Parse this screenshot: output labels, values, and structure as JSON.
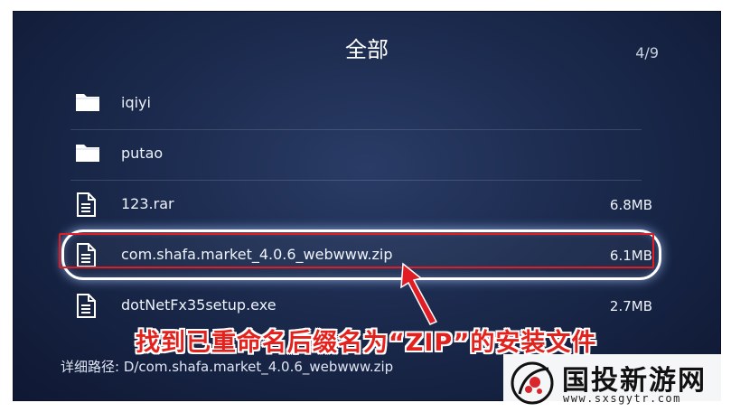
{
  "header": {
    "title": "全部",
    "page_counter": "4/9"
  },
  "files": [
    {
      "name": "iqiyi",
      "size": "",
      "icon": "folder-icon"
    },
    {
      "name": "putao",
      "size": "",
      "icon": "folder-icon"
    },
    {
      "name": "123.rar",
      "size": "6.8MB",
      "icon": "file-icon"
    },
    {
      "name": "com.shafa.market_4.0.6_webwww.zip",
      "size": "6.1MB",
      "icon": "file-icon",
      "selected": true
    },
    {
      "name": "dotNetFx35setup.exe",
      "size": "2.7MB",
      "icon": "file-icon"
    }
  ],
  "detail": {
    "path": "详细路径: D/com.shafa.market_4.0.6_webwww.zip"
  },
  "annotation": {
    "caption": "找到已重命名后缀名为“ZIP”的安装文件",
    "color": "#e4221d"
  },
  "watermark": {
    "name": "国投新游网",
    "url": "www.sxsgytr.com"
  }
}
